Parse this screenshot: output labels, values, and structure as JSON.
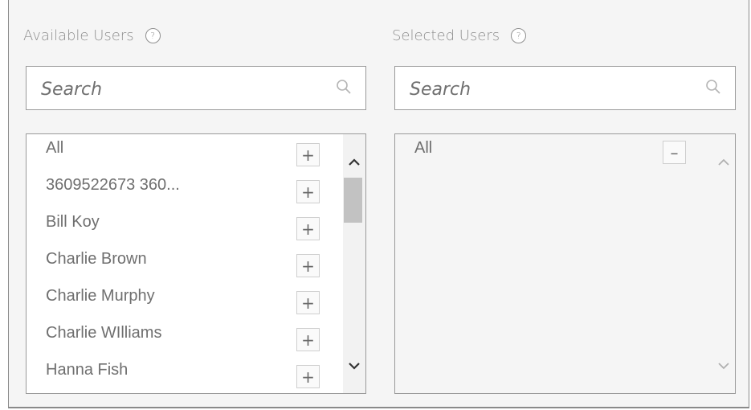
{
  "available": {
    "header": "Available Users",
    "help": "?",
    "search_placeholder": "Search",
    "add_symbol": "+",
    "items": [
      "All",
      "3609522673 360...",
      "Bill Koy",
      "Charlie Brown",
      "Charlie Murphy",
      "Charlie WIlliams",
      "Hanna Fish"
    ]
  },
  "selected": {
    "header": "Selected Users",
    "help": "?",
    "search_placeholder": "Search",
    "remove_symbol": "–",
    "items": [
      "All"
    ]
  },
  "icons": {
    "search": "search-icon",
    "help": "help-icon",
    "scroll_up": "chevron-up-icon",
    "scroll_down": "chevron-down-icon"
  },
  "colors": {
    "frame_bg": "#f5f5f5",
    "list_bg": "#ffffff",
    "text": "#6f6f6f",
    "border": "#9a9a9a",
    "scrollbar_thumb": "#c2c2c2"
  }
}
